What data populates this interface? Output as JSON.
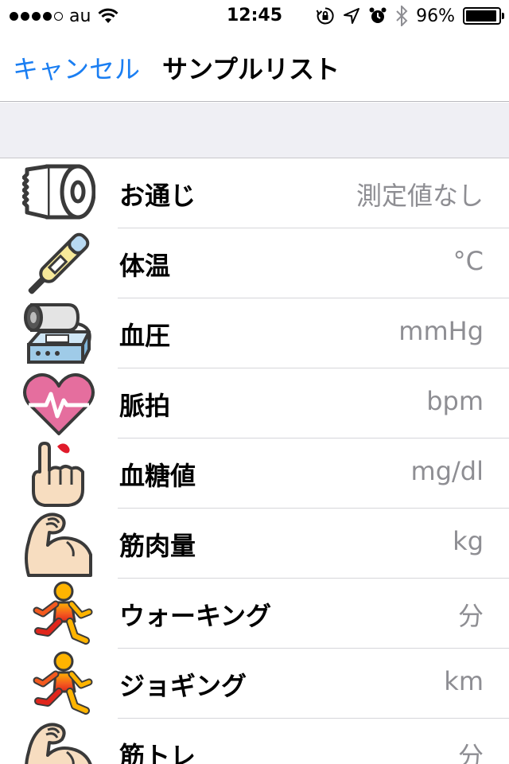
{
  "status_bar": {
    "carrier": "au",
    "time": "12:45",
    "battery": "96%",
    "battery_level": 0.96
  },
  "nav": {
    "cancel_label": "キャンセル",
    "title": "サンプルリスト"
  },
  "items": [
    {
      "icon": "toilet-paper-icon",
      "label": "お通じ",
      "value": "測定値なし"
    },
    {
      "icon": "thermometer-icon",
      "label": "体温",
      "value": "°C"
    },
    {
      "icon": "blood-pressure-monitor-icon",
      "label": "血圧",
      "value": "mmHg"
    },
    {
      "icon": "heart-pulse-icon",
      "label": "脈拍",
      "value": "bpm"
    },
    {
      "icon": "finger-blood-drop-icon",
      "label": "血糖値",
      "value": "mg/dl"
    },
    {
      "icon": "flexed-arm-icon",
      "label": "筋肉量",
      "value": "kg"
    },
    {
      "icon": "walking-figure-icon",
      "label": "ウォーキング",
      "value": "分"
    },
    {
      "icon": "jogging-figure-icon",
      "label": "ジョギング",
      "value": "km"
    },
    {
      "icon": "flexed-arm-icon",
      "label": "筋トレ",
      "value": "分"
    }
  ],
  "colors": {
    "accent": "#1a7ef2",
    "value_text": "#8e8e93",
    "section_background": "#efeff4"
  }
}
